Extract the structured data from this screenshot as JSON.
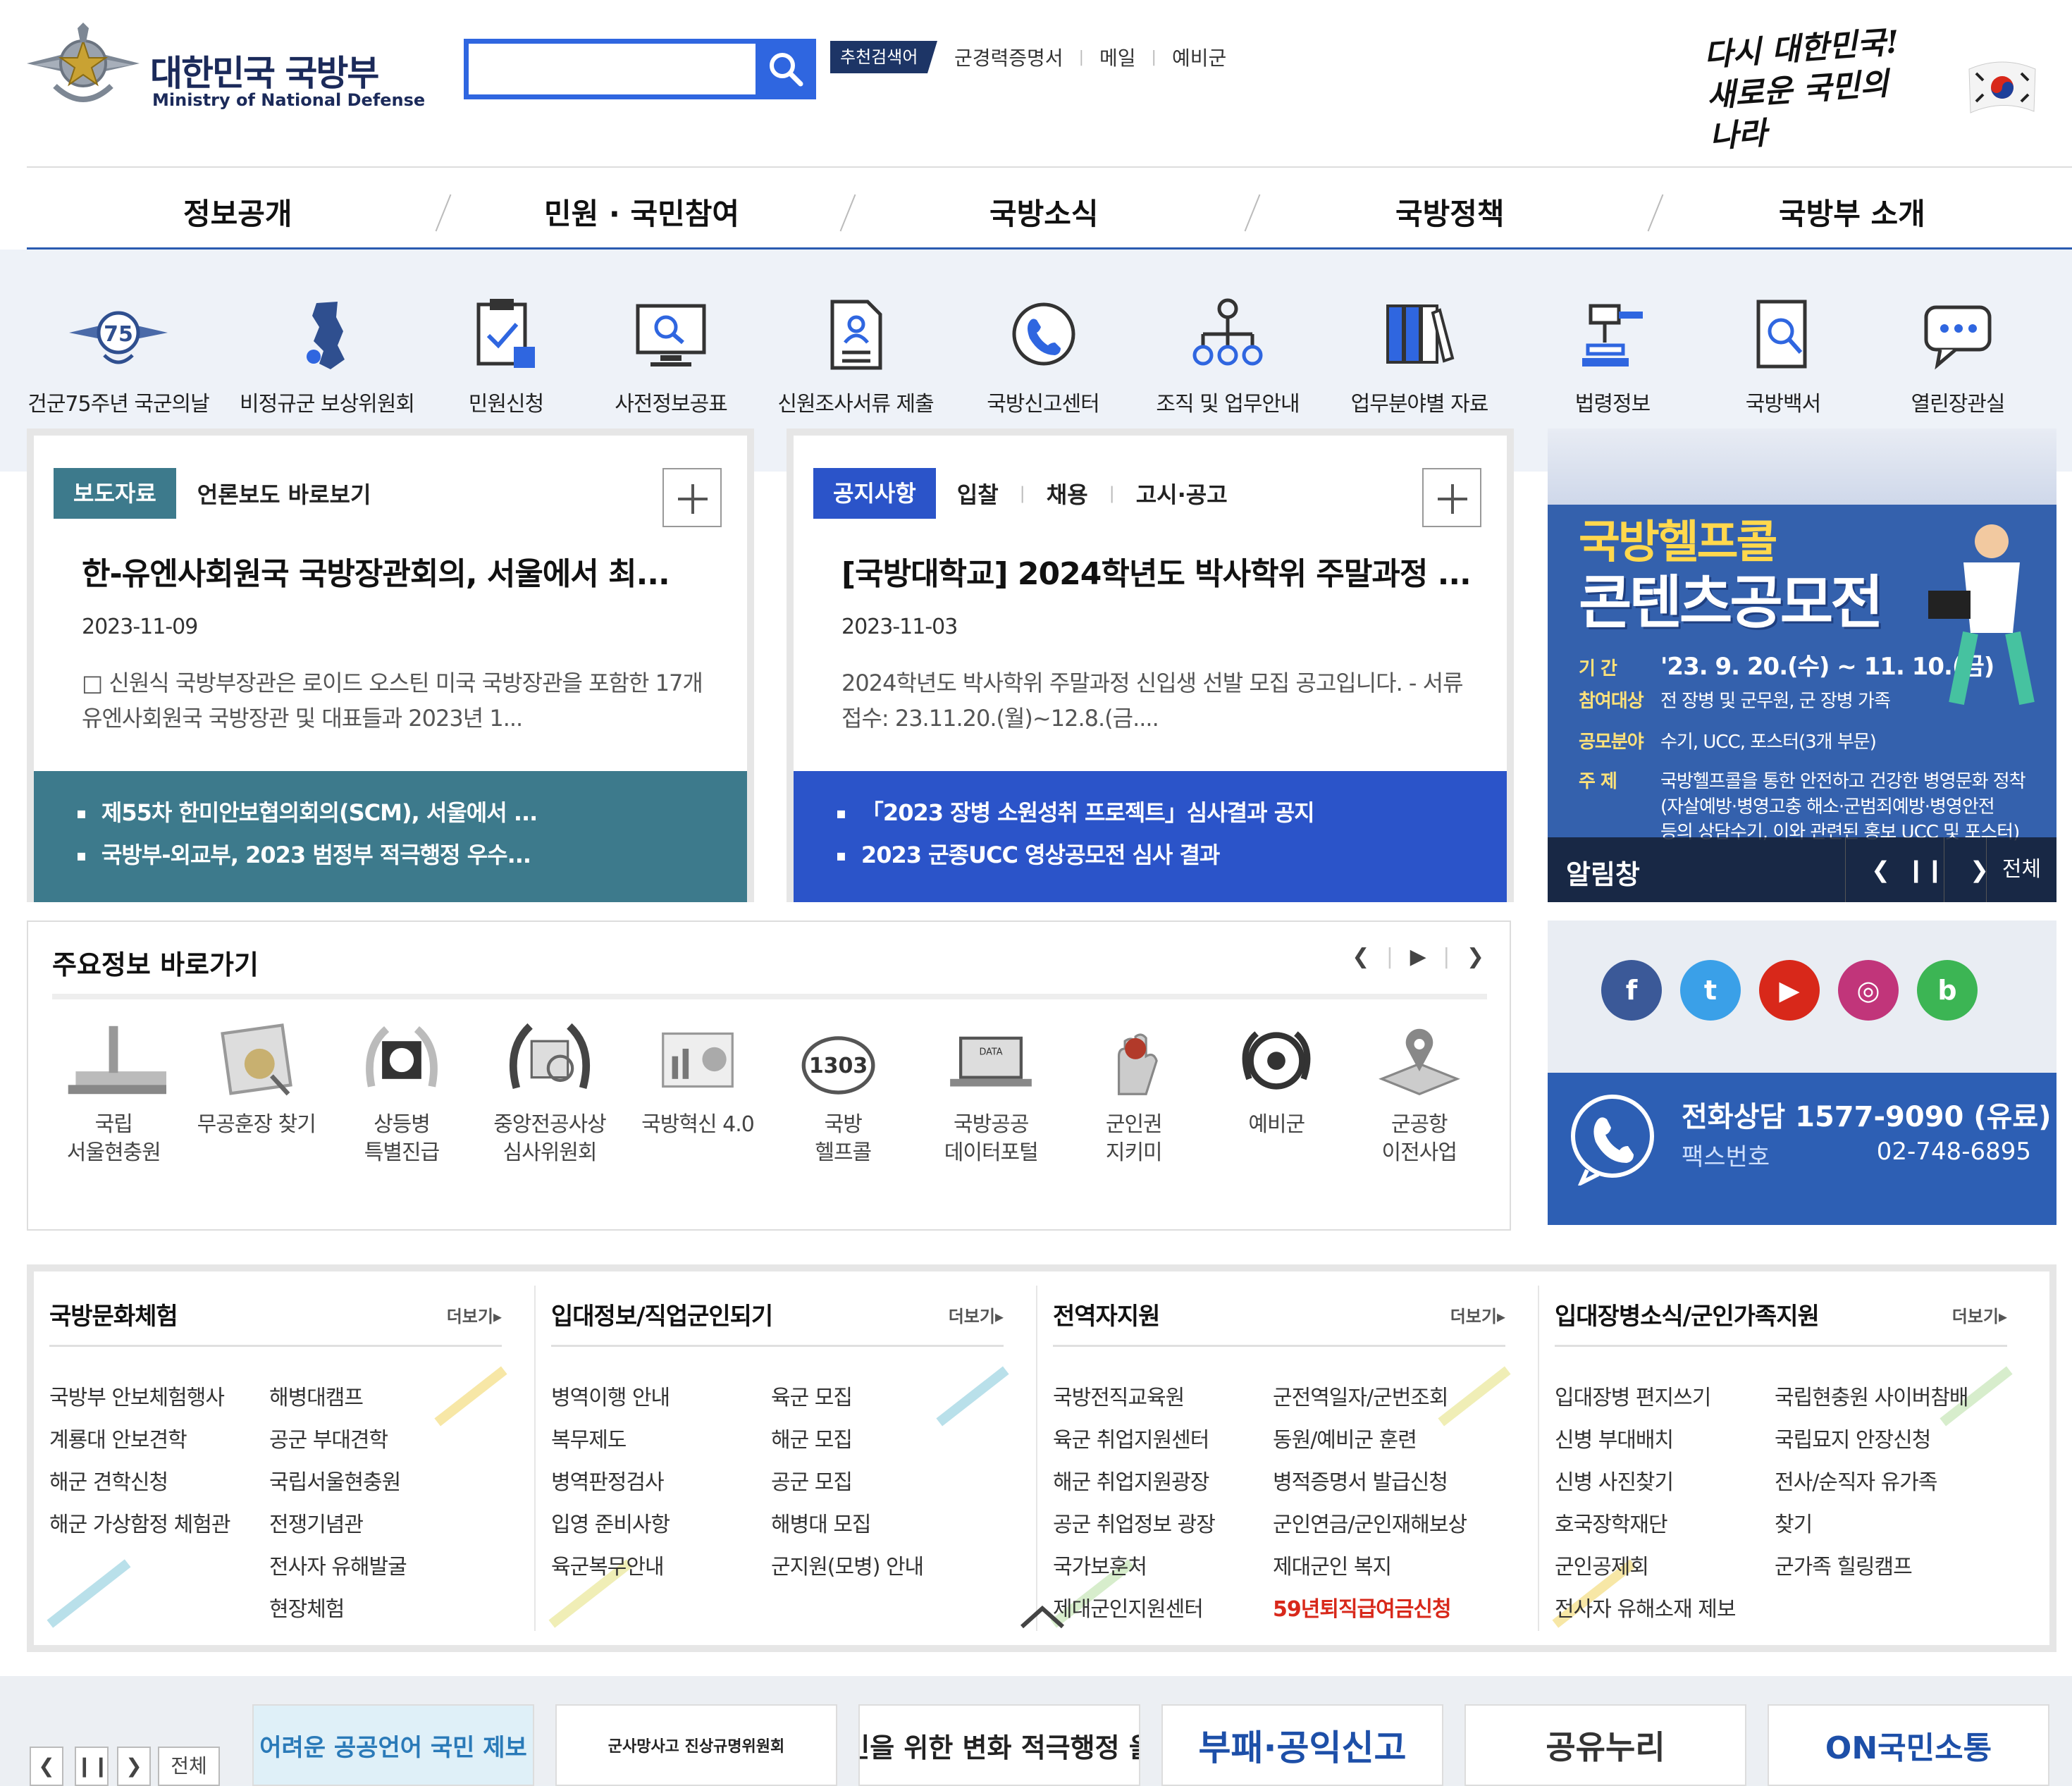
{
  "header": {
    "ministry_ko": "대한민국 국방부",
    "ministry_en": "Ministry of National Defense",
    "search_placeholder": "",
    "recommend_label": "추천검색어",
    "toplinks": [
      "군경력증명서",
      "메일",
      "예비군"
    ],
    "slogan_line1": "다시 대한민국!",
    "slogan_line2": "새로운 국민의 나라"
  },
  "gnb": [
    "정보공개",
    "민원 · 국민참여",
    "국방소식",
    "국방정책",
    "국방부 소개"
  ],
  "quick_icons": [
    {
      "label": "건군75주년 국군의날",
      "icon": "anniversary-75-icon"
    },
    {
      "label": "비정규군 보상위원회",
      "icon": "korea-map-icon"
    },
    {
      "label": "민원신청",
      "icon": "document-pen-icon"
    },
    {
      "label": "사전정보공표",
      "icon": "monitor-search-icon"
    },
    {
      "label": "신원조사서류 제출",
      "icon": "person-document-icon"
    },
    {
      "label": "국방신고센터",
      "icon": "phone-chat-icon"
    },
    {
      "label": "조직 및 업무안내",
      "icon": "org-chart-icon"
    },
    {
      "label": "업무분야별 자료",
      "icon": "binders-icon"
    },
    {
      "label": "법령정보",
      "icon": "gavel-icon"
    },
    {
      "label": "국방백서",
      "icon": "book-search-icon"
    },
    {
      "label": "열린장관실",
      "icon": "chat-bubble-icon"
    }
  ],
  "press": {
    "tab_active": "보도자료",
    "tab_other": "언론보도 바로보기",
    "title": "한-유엔사회원국 국방장관회의, 서울에서 최...",
    "date": "2023-11-09",
    "body": "□ 신원식 국방부장관은 로이드 오스틴 미국 국방장관을 포함한 17개 유엔사회원국 국방장관 및 대표들과 2023년 1...",
    "list": [
      "제55차 한미안보협의회의(SCM), 서울에서 ...",
      "국방부-외교부, 2023 범정부 적극행정 우수..."
    ],
    "accent": "#3d7a8c"
  },
  "notice": {
    "tab_active": "공지사항",
    "tabs": [
      "입찰",
      "채용",
      "고시·공고"
    ],
    "title": "[국방대학교] 2024학년도 박사학위 주말과정 ...",
    "date": "2023-11-03",
    "body": "2024학년도 박사학위 주말과정 신입생 선발 모집 공고입니다. - 서류 접수: 23.11.20.(월)~12.8.(금....",
    "list": [
      "「2023 장병 소원성취 프로젝트」심사결과 공지",
      "2023 군종UCC 영상공모전 심사 결과"
    ],
    "accent": "#2b54c9"
  },
  "banner": {
    "h1": "국방헬프콜",
    "h2": "콘텐츠공모전",
    "rows": [
      {
        "k": "기   간",
        "v": "'23. 9. 20.(수) ~ 11. 10.(금)"
      },
      {
        "k": "참여대상",
        "v": "전 장병 및 군무원, 군 장병 가족"
      },
      {
        "k": "공모분야",
        "v": "수기, UCC, 포스터(3개 부문)"
      },
      {
        "k": "주   제",
        "v": "국방헬프콜을 통한 안전하고 건강한 병영문화 정착"
      },
      {
        "k": "",
        "v": "(자살예방·병영고충 해소·군범죄예방·병영안전"
      },
      {
        "k": "",
        "v": "등의 상담수기, 이와 관련된 홍보 UCC 및 포스터)"
      }
    ],
    "foot_title": "알림창",
    "all_label": "전체"
  },
  "main_info": {
    "title": "주요정보 바로가기",
    "items": [
      {
        "label": "국립\n서울현충원",
        "icon": "memorial-icon"
      },
      {
        "label": "무공훈장 찾기",
        "icon": "medal-frame-icon"
      },
      {
        "label": "상등병\n특별진급",
        "icon": "rank-wreath-icon"
      },
      {
        "label": "중앙전공사상\n심사위원회",
        "icon": "committee-wreath-icon"
      },
      {
        "label": "국방혁신 4.0",
        "icon": "innovation-book-icon"
      },
      {
        "label": "국방\n헬프콜",
        "icon": "helpcall-1303-icon"
      },
      {
        "label": "국방공공\n데이터포털",
        "icon": "data-laptop-icon"
      },
      {
        "label": "군인권\n지키미",
        "icon": "hand-icon"
      },
      {
        "label": "예비군",
        "icon": "reserve-emblem-icon"
      },
      {
        "label": "군공항\n이전사업",
        "icon": "map-pin-icon"
      }
    ]
  },
  "sns": [
    {
      "name": "facebook-icon",
      "glyph": "f",
      "color": "#3b5998"
    },
    {
      "name": "twitter-icon",
      "glyph": "t",
      "color": "#3aa0e8"
    },
    {
      "name": "youtube-icon",
      "glyph": "▶",
      "color": "#d8281a"
    },
    {
      "name": "instagram-icon",
      "glyph": "◎",
      "color": "#c1357a"
    },
    {
      "name": "blog-icon",
      "glyph": "b",
      "color": "#3cb554"
    }
  ],
  "call": {
    "line1": "전화상담 1577-9090 (유료)",
    "fax_label": "팩스번호",
    "fax": "02-748-6895"
  },
  "menus": [
    {
      "title": "국방문화체험",
      "more": "더보기▸",
      "a": [
        "국방부 안보체험행사",
        "계룡대 안보견학",
        "해군 견학신청",
        "해군 가상함정 체험관"
      ],
      "b": [
        "해병대캠프",
        "공군 부대견학",
        "국립서울현충원",
        "전쟁기념관",
        "전사자 유해발굴",
        "현장체험"
      ]
    },
    {
      "title": "입대정보/직업군인되기",
      "more": "더보기▸",
      "a": [
        "병역이행 안내",
        "복무제도",
        "병역판정검사",
        "입영 준비사항",
        "육군복무안내"
      ],
      "b": [
        "육군 모집",
        "해군 모집",
        "공군 모집",
        "해병대 모집",
        "군지원(모병) 안내"
      ]
    },
    {
      "title": "전역자지원",
      "more": "더보기▸",
      "a": [
        "국방전직교육원",
        "육군 취업지원센터",
        "해군 취업지원광장",
        "공군 취업정보 광장",
        "국가보훈처",
        "제대군인지원센터"
      ],
      "b": [
        "군전역일자/군번조회",
        "동원/예비군 훈련",
        "병적증명서 발급신청",
        "군인연금/군인재해보상",
        "제대군인 복지"
      ],
      "b_red": "59년퇴직급여금신청"
    },
    {
      "title": "입대장병소식/군인가족지원",
      "more": "더보기▸",
      "a": [
        "입대장병 편지쓰기",
        "신병 부대배치",
        "신병 사진찾기",
        "호국장학재단",
        "군인공제회",
        "전사자 유해소재 제보"
      ],
      "b": [
        "국립현충원 사이버참배",
        "국립묘지 안장신청",
        "전사/순직자 유가족",
        "찾기",
        "군가족 힐링캠프"
      ]
    }
  ],
  "bottom": {
    "all_label": "전체",
    "banners": [
      "어려운 공공언어 국민 제보",
      "군사망사고 진상규명위원회",
      "국민을 위한 변화 적극행정 울림",
      "부패·공익신고",
      "공유누리",
      "ON국민소통"
    ]
  }
}
